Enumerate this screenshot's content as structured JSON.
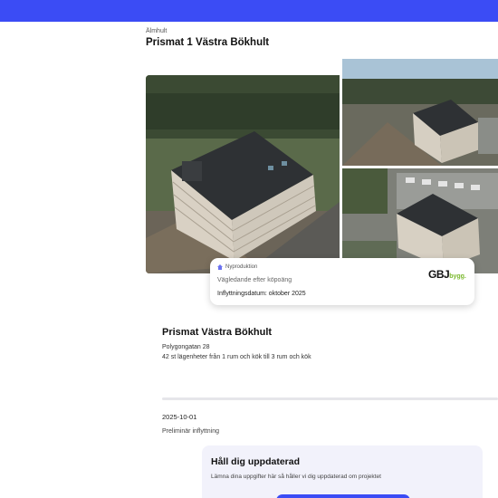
{
  "header": {
    "breadcrumb": "Älmhult",
    "title": "Prismat 1 Västra Bökhult",
    "brand_color": "#3b4cf5"
  },
  "info_card": {
    "badge": "Nyproduktion",
    "badge_icon": "house-icon",
    "line1": "Vägledande efter köpoäng",
    "line2": "Inflyttningsdatum: oktober 2025",
    "logo_main": "GBJ",
    "logo_sub": "bygg."
  },
  "project": {
    "title": "Prismat Västra Bökhult",
    "address": "Polygongatan 28",
    "apartments": "42 st lägenheter från 1 rum och kök till 3 rum och kök"
  },
  "timeline": {
    "date": "2025-10-01",
    "label": "Preliminär inflyttning"
  },
  "subscribe": {
    "title": "Håll dig uppdaterad",
    "text": "Lämna dina uppgifter här så håller vi dig uppdaterad om projektet"
  }
}
